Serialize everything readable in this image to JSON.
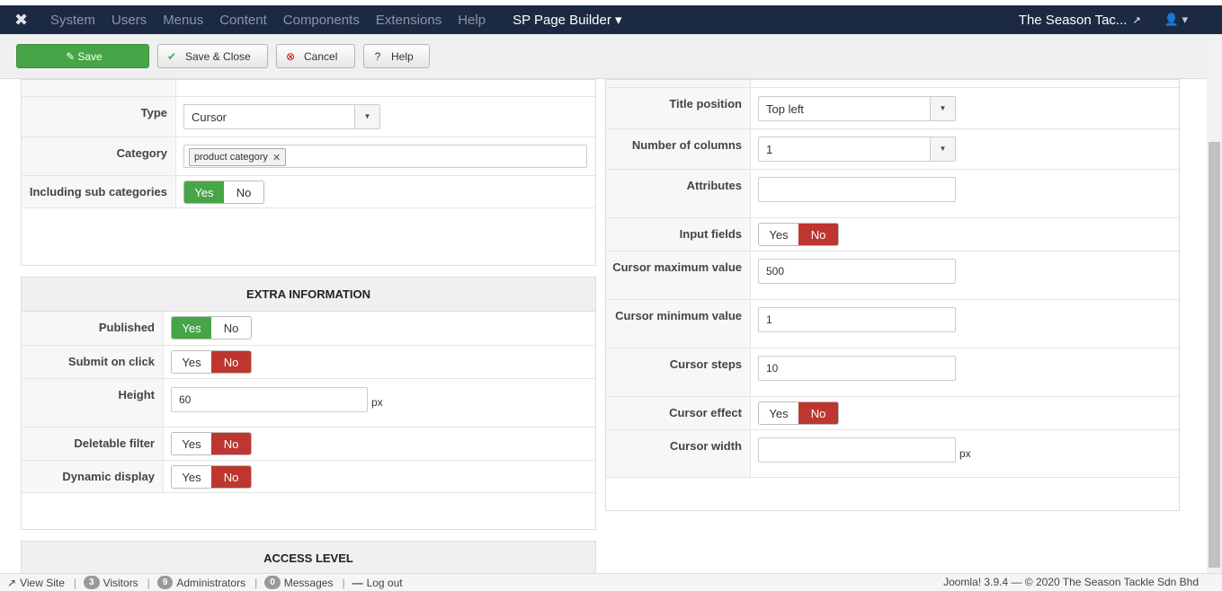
{
  "navbar": {
    "menu": [
      "System",
      "Users",
      "Menus",
      "Content",
      "Components",
      "Extensions",
      "Help"
    ],
    "sp_page_builder": "SP Page Builder ▾",
    "site_name": "The Season Tac...",
    "user_caret": "▾"
  },
  "toolbar": {
    "save": "Save",
    "save_close": "Save & Close",
    "cancel": "Cancel",
    "help": "Help"
  },
  "left_panel": {
    "type_label": "Type",
    "type_value": "Cursor",
    "category_label": "Category",
    "category_chip": "product category",
    "sub_categories_label": "Including sub categories"
  },
  "extra_info": {
    "header": "EXTRA INFORMATION",
    "published_label": "Published",
    "submit_label": "Submit on click",
    "height_label": "Height",
    "height_value": "60",
    "height_unit": "px",
    "deletable_label": "Deletable filter",
    "dynamic_label": "Dynamic display"
  },
  "access": {
    "header": "ACCESS LEVEL"
  },
  "toggle": {
    "yes": "Yes",
    "no": "No"
  },
  "right_panel": {
    "title_position_label": "Title position",
    "title_position_value": "Top left",
    "columns_label": "Number of columns",
    "columns_value": "1",
    "attributes_label": "Attributes",
    "attributes_value": "",
    "input_fields_label": "Input fields",
    "cursor_max_label": "Cursor maximum value",
    "cursor_max_value": "500",
    "cursor_min_label": "Cursor minimum value",
    "cursor_min_value": "1",
    "cursor_steps_label": "Cursor steps",
    "cursor_steps_value": "10",
    "cursor_effect_label": "Cursor effect",
    "cursor_width_label": "Cursor width",
    "cursor_width_value": "",
    "cursor_width_unit": "px"
  },
  "statusbar": {
    "view_site": "View Site",
    "visitors_count": "3",
    "visitors": "Visitors",
    "admins_count": "9",
    "admins": "Administrators",
    "messages_count": "0",
    "messages": "Messages",
    "logout": "Log out",
    "copyright": "Joomla! 3.9.4 — © 2020 The Season Tackle Sdn Bhd"
  },
  "colors": {
    "navbar": "#1b2a42",
    "success": "#46a546",
    "danger": "#bd362f"
  }
}
